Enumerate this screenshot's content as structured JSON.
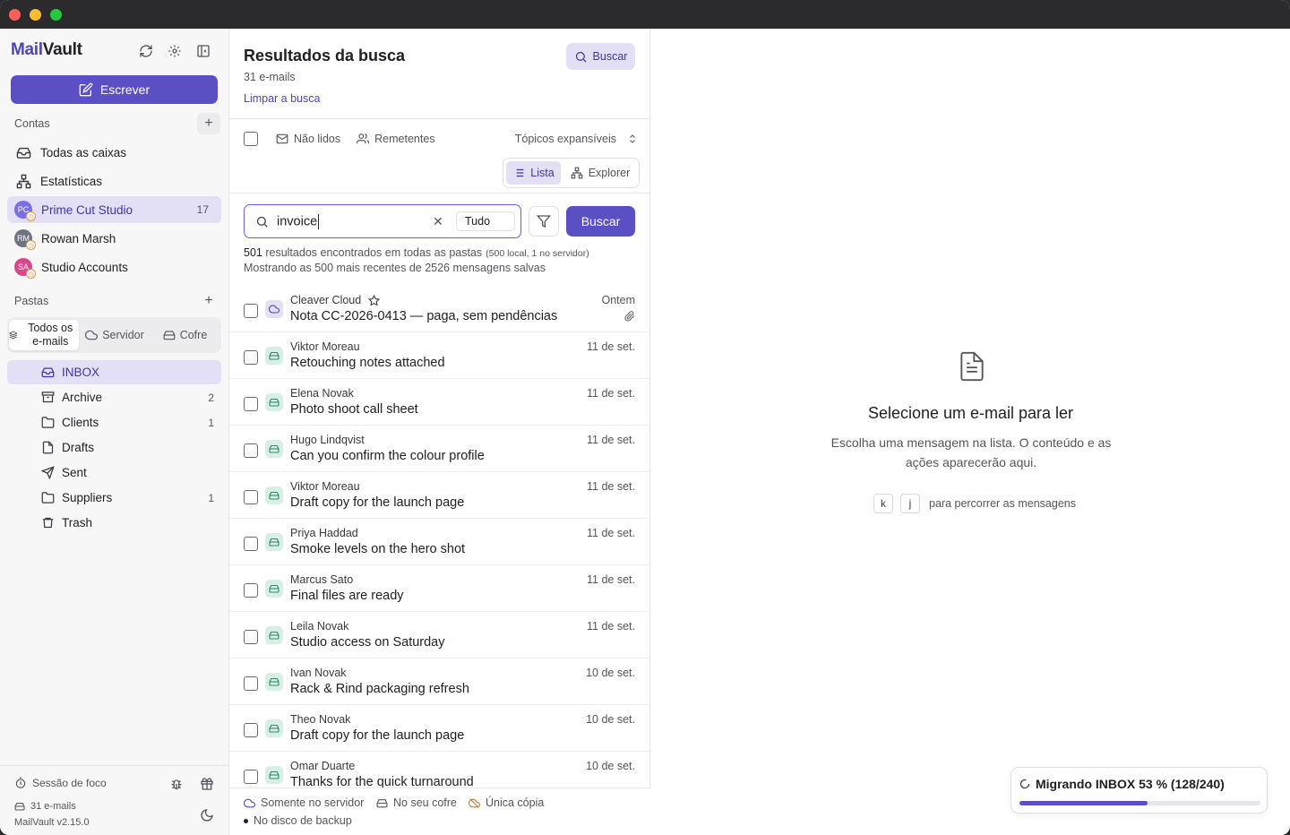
{
  "app": {
    "logo_a": "Mail",
    "logo_b": "Vault",
    "compose_label": "Escrever"
  },
  "accounts": {
    "label": "Contas",
    "items": [
      {
        "label": "Todas as caixas",
        "icon": "inbox-icon"
      },
      {
        "label": "Estatísticas",
        "icon": "sitemap-icon"
      },
      {
        "label": "Prime Cut Studio",
        "initials": "PC",
        "count": "17",
        "color": "#7c6ee6",
        "selected": true
      },
      {
        "label": "Rowan Marsh",
        "initials": "RM",
        "color": "#6d7480"
      },
      {
        "label": "Studio Accounts",
        "initials": "SA",
        "color": "#d9468a"
      }
    ]
  },
  "folders": {
    "label": "Pastas",
    "tabs": [
      {
        "label": "Todos os e-mails",
        "active": true
      },
      {
        "label": "Servidor"
      },
      {
        "label": "Cofre"
      }
    ],
    "items": [
      {
        "label": "INBOX",
        "icon": "inbox-icon",
        "count": "",
        "selected": true
      },
      {
        "label": "Archive",
        "icon": "archive-icon",
        "count": "2"
      },
      {
        "label": "Clients",
        "icon": "folder-icon",
        "count": "1"
      },
      {
        "label": "Drafts",
        "icon": "file-icon",
        "count": ""
      },
      {
        "label": "Sent",
        "icon": "send-icon",
        "count": ""
      },
      {
        "label": "Suppliers",
        "icon": "folder-icon",
        "count": "1"
      },
      {
        "label": "Trash",
        "icon": "trash-icon",
        "count": ""
      }
    ]
  },
  "footer": {
    "focus_session": "Sessão de foco",
    "email_count": "31 e-mails",
    "version": "MailVault v2.15.0"
  },
  "results": {
    "title": "Resultados da busca",
    "count": "31 e-mails",
    "clear": "Limpar a busca",
    "top_search": "Buscar",
    "filter_unread": "Não lidos",
    "filter_senders": "Remetentes",
    "expandable": "Tópicos expansíveis",
    "view_list": "Lista",
    "view_explorer": "Explorer",
    "query": "invoice",
    "scope": "Tudo",
    "search_button": "Buscar",
    "found_num": "501",
    "found_text": "resultados encontrados em todas as pastas",
    "found_detail": "(500 local, 1 no servidor)",
    "showing": "Mostrando as 500 mais recentes de 2526 mensagens salvas"
  },
  "emails": [
    {
      "sender": "Cleaver Cloud",
      "subject": "Nota CC-2026-0413 — paga, sem pendências",
      "date": "Ontem",
      "source": "cloud",
      "starred": true,
      "attachment": true
    },
    {
      "sender": "Viktor Moreau",
      "subject": "Retouching notes attached",
      "date": "11 de set.",
      "source": "vault"
    },
    {
      "sender": "Elena Novak",
      "subject": "Photo shoot call sheet",
      "date": "11 de set.",
      "source": "vault"
    },
    {
      "sender": "Hugo Lindqvist",
      "subject": "Can you confirm the colour profile",
      "date": "11 de set.",
      "source": "vault"
    },
    {
      "sender": "Viktor Moreau",
      "subject": "Draft copy for the launch page",
      "date": "11 de set.",
      "source": "vault"
    },
    {
      "sender": "Priya Haddad",
      "subject": "Smoke levels on the hero shot",
      "date": "11 de set.",
      "source": "vault"
    },
    {
      "sender": "Marcus Sato",
      "subject": "Final files are ready",
      "date": "11 de set.",
      "source": "vault"
    },
    {
      "sender": "Leila Novak",
      "subject": "Studio access on Saturday",
      "date": "11 de set.",
      "source": "vault"
    },
    {
      "sender": "Ivan Novak",
      "subject": "Rack & Rind packaging refresh",
      "date": "10 de set.",
      "source": "vault"
    },
    {
      "sender": "Theo Novak",
      "subject": "Draft copy for the launch page",
      "date": "10 de set.",
      "source": "vault"
    },
    {
      "sender": "Omar Duarte",
      "subject": "Thanks for the quick turnaround",
      "date": "10 de set.",
      "source": "vault"
    }
  ],
  "legend": {
    "server_only": "Somente no servidor",
    "in_vault": "No seu cofre",
    "single_copy": "Única cópia",
    "backup_disk": "No disco de backup"
  },
  "reader": {
    "empty_title": "Selecione um e-mail para ler",
    "empty_desc": "Escolha uma mensagem na lista. O conteúdo e as ações aparecerão aqui.",
    "key_k": "k",
    "key_j": "j",
    "key_hint": "para percorrer as mensagens"
  },
  "migration": {
    "label": "Migrando INBOX 53 % (128/240)",
    "progress": 0.53
  },
  "colors": {
    "accent": "#5b4fc4",
    "accent_soft": "#e3e0f5",
    "vault": "#2f8a66"
  }
}
